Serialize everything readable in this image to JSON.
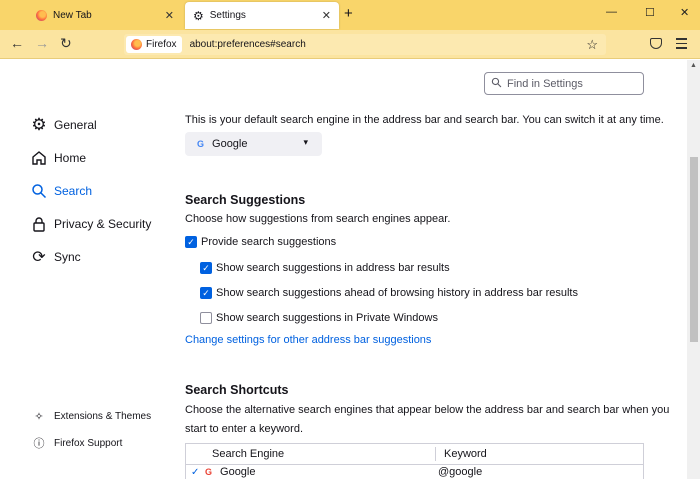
{
  "tabs": [
    {
      "label": "New Tab",
      "active": false
    },
    {
      "label": "Settings",
      "active": true
    }
  ],
  "navbar": {
    "identity_label": "Firefox",
    "url": "about:preferences#search"
  },
  "search": {
    "placeholder": "Find in Settings"
  },
  "sidebar": {
    "items": [
      {
        "label": "General"
      },
      {
        "label": "Home"
      },
      {
        "label": "Search"
      },
      {
        "label": "Privacy & Security"
      },
      {
        "label": "Sync"
      }
    ],
    "footer": [
      {
        "label": "Extensions & Themes"
      },
      {
        "label": "Firefox Support"
      }
    ]
  },
  "main": {
    "default_engine_desc": "This is your default search engine in the address bar and search bar. You can switch it at any time.",
    "default_engine": "Google",
    "suggestions": {
      "title": "Search Suggestions",
      "desc": "Choose how suggestions from search engines appear.",
      "options": [
        {
          "label": "Provide search suggestions",
          "checked": true
        },
        {
          "label": "Show search suggestions in address bar results",
          "checked": true
        },
        {
          "label": "Show search suggestions ahead of browsing history in address bar results",
          "checked": true
        },
        {
          "label": "Show search suggestions in Private Windows",
          "checked": false
        }
      ],
      "link": "Change settings for other address bar suggestions"
    },
    "shortcuts": {
      "title": "Search Shortcuts",
      "desc_line1": "Choose the alternative search engines that appear below the address bar and search bar when you",
      "desc_line2": "start to enter a keyword.",
      "columns": [
        "Search Engine",
        "Keyword"
      ],
      "rows": [
        {
          "engine": "Google",
          "keyword": "@google"
        }
      ]
    }
  },
  "colors": {
    "accent": "#0061e0",
    "tabstrip": "#f9d56a",
    "navbar": "#fbe4a0"
  }
}
